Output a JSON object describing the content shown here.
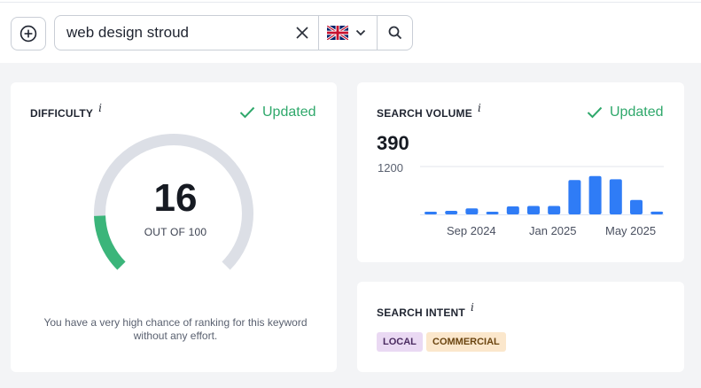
{
  "search": {
    "query": "web design stroud",
    "country_flag": "uk-flag-icon"
  },
  "difficulty": {
    "title": "DIFFICULTY",
    "info": "i",
    "status": "Updated",
    "score": "16",
    "score_max_label": "OUT OF 100",
    "gauge_fraction": 0.16,
    "note": "You have a very high chance of ranking for this keyword without any effort.",
    "colors": {
      "fill": "#3bb57a",
      "track": "#dcdfe6"
    }
  },
  "search_volume": {
    "title": "SEARCH VOLUME",
    "info": "i",
    "status": "Updated",
    "value": "390"
  },
  "chart_data": {
    "type": "bar",
    "title": "",
    "ylim": [
      0,
      1200
    ],
    "yticks": [
      "1200"
    ],
    "x_tick_labels": [
      "Sep 2024",
      "Jan 2025",
      "May 2025"
    ],
    "values": [
      50,
      90,
      150,
      50,
      200,
      210,
      210,
      860,
      960,
      880,
      360,
      70
    ],
    "bar_color": "#2f7cf6",
    "grid": true
  },
  "search_intent": {
    "title": "SEARCH INTENT",
    "info": "i",
    "tags": [
      {
        "label": "LOCAL",
        "bg": "#ead9f3",
        "fg": "#4a2a60"
      },
      {
        "label": "COMMERCIAL",
        "bg": "#fbe7cc",
        "fg": "#6b4510"
      }
    ]
  }
}
